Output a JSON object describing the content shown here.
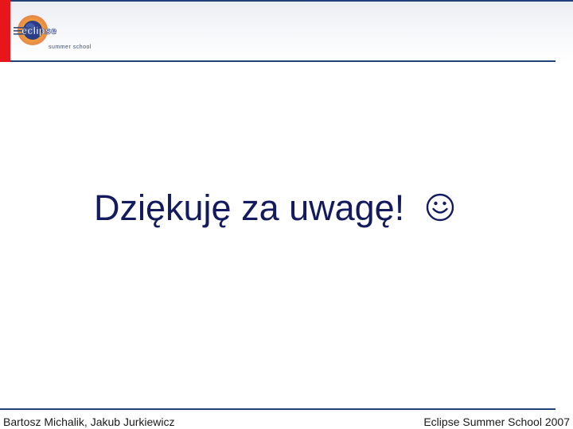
{
  "header": {
    "logo_text": "eclipse",
    "logo_subtitle": "summer school"
  },
  "main": {
    "message": "Dziękuję za uwagę!",
    "emoticon": "smiley-icon"
  },
  "footer": {
    "authors": "Bartosz Michalik, Jakub Jurkiewicz",
    "event": "Eclipse Summer School 2007"
  },
  "colors": {
    "accent_red": "#e8151b",
    "rule_blue": "#20407a",
    "title_navy": "#131a5e"
  }
}
